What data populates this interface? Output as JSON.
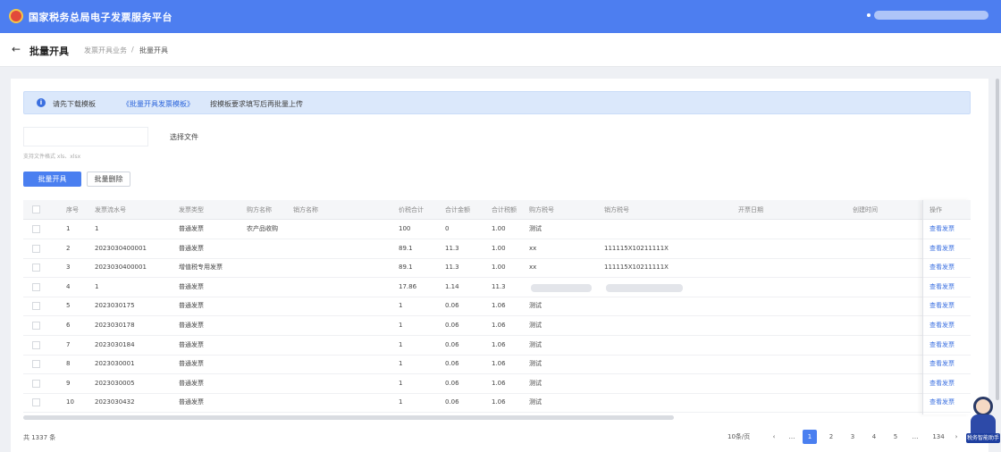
{
  "topbar": {
    "title": "国家税务总局电子发票服务平台"
  },
  "subheader": {
    "back_icon": "←",
    "title": "批量开具",
    "crumb1": "发票开具业务",
    "crumb_sep": "/",
    "crumb2": "批量开具"
  },
  "notice": {
    "icon": "i",
    "text1": "请先下载模板",
    "link": "《批量开具发票模板》",
    "text2": "按模板要求填写后再批量上传"
  },
  "upload": {
    "select_label": "选择文件",
    "hint": "支持文件格式 xls、xlsx"
  },
  "buttons": {
    "primary": "批量开具",
    "secondary": "批量删除"
  },
  "table": {
    "headers": [
      "序号",
      "发票流水号",
      "发票类型",
      "购方名称",
      "销方名称",
      "价税合计",
      "合计金额",
      "合计税额",
      "购方税号",
      "销方税号",
      "开票日期",
      "创建时间",
      "操作"
    ],
    "rows": [
      [
        "1",
        "1",
        "普通发票",
        "农产品收购",
        "",
        "100",
        "0",
        "1.00",
        "测试",
        "",
        "",
        "",
        "查看发票"
      ],
      [
        "2",
        "2023030400001",
        "普通发票",
        "",
        "",
        "89.1",
        "11.3",
        "1.00",
        "xx",
        "111115X10211111X",
        "",
        "",
        "查看发票"
      ],
      [
        "3",
        "2023030400001",
        "增值税专用发票",
        "",
        "",
        "89.1",
        "11.3",
        "1.00",
        "xx",
        "111115X10211111X",
        "",
        "",
        "查看发票"
      ],
      [
        "4",
        "1",
        "普通发票",
        "",
        "",
        "17.86",
        "1.14",
        "11.3",
        "",
        "",
        "",
        "",
        "查看发票"
      ],
      [
        "5",
        "2023030175",
        "普通发票",
        "",
        "",
        "1",
        "0.06",
        "1.06",
        "测试",
        "",
        "",
        "",
        "查看发票"
      ],
      [
        "6",
        "2023030178",
        "普通发票",
        "",
        "",
        "1",
        "0.06",
        "1.06",
        "测试",
        "",
        "",
        "",
        "查看发票"
      ],
      [
        "7",
        "2023030184",
        "普通发票",
        "",
        "",
        "1",
        "0.06",
        "1.06",
        "测试",
        "",
        "",
        "",
        "查看发票"
      ],
      [
        "8",
        "2023030001",
        "普通发票",
        "",
        "",
        "1",
        "0.06",
        "1.06",
        "测试",
        "",
        "",
        "",
        "查看发票"
      ],
      [
        "9",
        "2023030005",
        "普通发票",
        "",
        "",
        "1",
        "0.06",
        "1.06",
        "测试",
        "",
        "",
        "",
        "查看发票"
      ],
      [
        "10",
        "2023030432",
        "普通发票",
        "",
        "",
        "1",
        "0.06",
        "1.06",
        "测试",
        "",
        "",
        "",
        "查看发票"
      ]
    ]
  },
  "footer": {
    "total": "共 1337 条",
    "page_size": "10条/页",
    "prev": "‹",
    "pages": [
      "1",
      "2",
      "3",
      "4",
      "5"
    ],
    "ellipsis": "…",
    "last": "134",
    "next": "›"
  },
  "mascot": {
    "label": "税务智能助手"
  }
}
